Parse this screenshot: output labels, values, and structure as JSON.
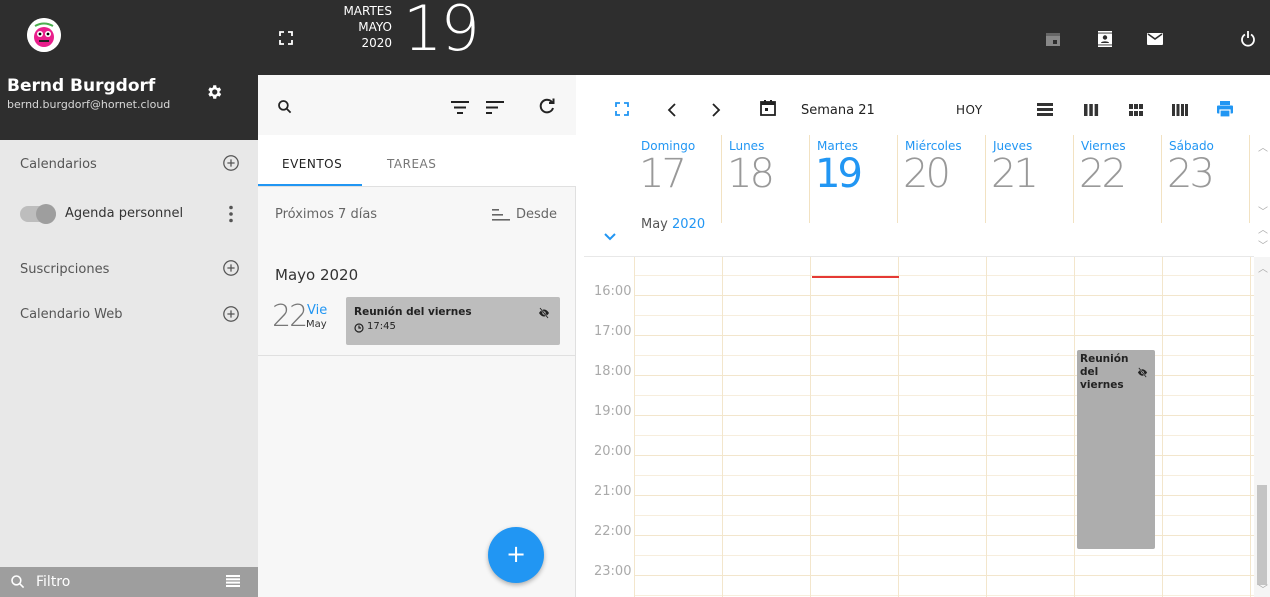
{
  "user": {
    "name": "Bernd Burgdorf",
    "email": "bernd.burgdorf@hornet.cloud"
  },
  "header": {
    "weekday": "MARTES",
    "month": "MAYO",
    "year": "2020",
    "day": "19"
  },
  "sidebar": {
    "calendars_label": "Calendarios",
    "agenda_label": "Agenda personnel",
    "subscriptions_label": "Suscripciones",
    "webcal_label": "Calendario Web",
    "filter_label": "Filtro"
  },
  "events_panel": {
    "tabs": [
      "EVENTOS",
      "TAREAS"
    ],
    "range_label": "Próximos 7 días",
    "sort_label": "Desde",
    "month_heading": "Mayo 2020",
    "event": {
      "day": "22",
      "dow": "Vie",
      "mon": "May",
      "title": "Reunión del viernes",
      "time": "17:45"
    },
    "add_label": "+"
  },
  "calendar": {
    "week_label": "Semana 21",
    "today_label": "HOY",
    "days": [
      {
        "name": "Domingo",
        "date": "17"
      },
      {
        "name": "Lunes",
        "date": "18"
      },
      {
        "name": "Martes",
        "date": "19",
        "today": true
      },
      {
        "name": "Miércoles",
        "date": "20"
      },
      {
        "name": "Jueves",
        "date": "21"
      },
      {
        "name": "Viernes",
        "date": "22"
      },
      {
        "name": "Sábado",
        "date": "23"
      }
    ],
    "month_label": "May",
    "year_label": "2020",
    "hours": [
      "16:00",
      "17:00",
      "18:00",
      "19:00",
      "20:00",
      "21:00",
      "22:00",
      "23:00"
    ],
    "event_title": "Reunión del viernes"
  },
  "colors": {
    "accent": "#2196f3",
    "dark": "#2e2e2e",
    "event": "#adadad",
    "now": "#e53935"
  }
}
